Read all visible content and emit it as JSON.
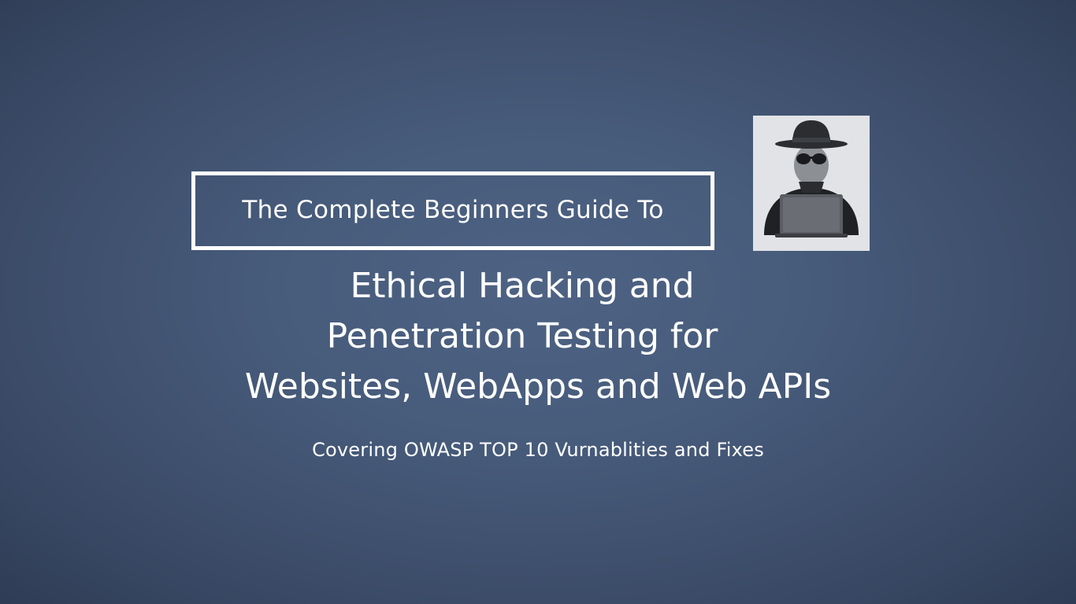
{
  "slide": {
    "guide_label": "The Complete Beginners Guide To",
    "title_lines": [
      "Ethical Hacking and",
      "Penetration Testing for",
      "Websites, WebApps and Web APIs"
    ],
    "subtitle": "Covering OWASP TOP 10 Vurnablities and Fixes"
  },
  "icons": {
    "hacker": "hacker-with-laptop-icon"
  },
  "colors": {
    "background": "#475b7b",
    "text": "#ffffff",
    "border": "#ffffff",
    "image_background": "#e1e3e7"
  }
}
